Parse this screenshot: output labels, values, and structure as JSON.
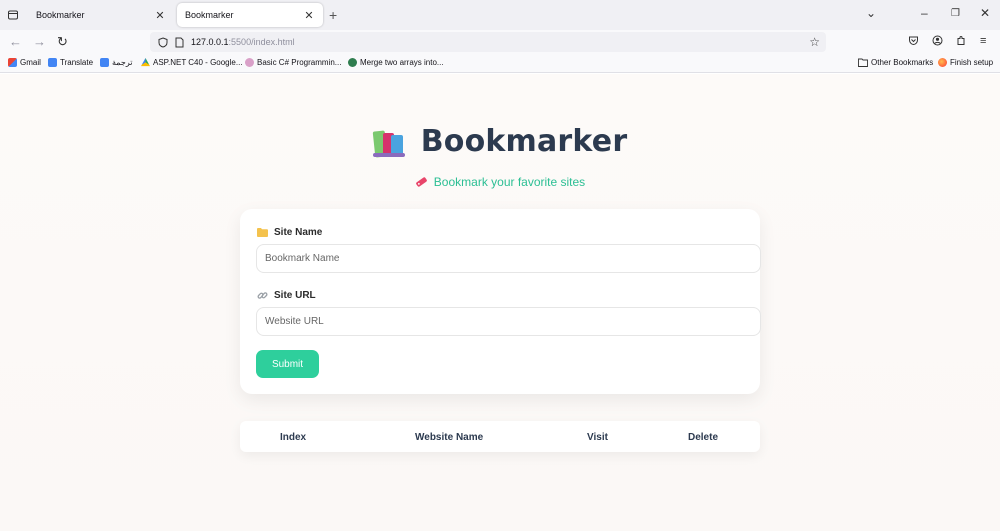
{
  "browser": {
    "tabs": [
      {
        "title": "Bookmarker",
        "active": false
      },
      {
        "title": "Bookmarker",
        "active": true
      }
    ],
    "url_host": "127.0.0.1",
    "url_rest": ":5500/index.html",
    "bookmarks": [
      {
        "label": "Gmail",
        "icon": "gmail-icon"
      },
      {
        "label": "Translate",
        "icon": "translate-icon"
      },
      {
        "label": "ترجمة",
        "icon": "translate-icon"
      },
      {
        "label": "ASP.NET C40 - Google...",
        "icon": "drive-icon"
      },
      {
        "label": "Basic C# Programmin...",
        "icon": "course-icon"
      },
      {
        "label": "Merge two arrays into...",
        "icon": "site-icon"
      }
    ],
    "other_bookmarks": "Other Bookmarks",
    "finish_setup": "Finish setup"
  },
  "app": {
    "title": "Bookmarker",
    "subtitle": "Bookmark your favorite sites",
    "form": {
      "site_name_label": "Site Name",
      "site_name_placeholder": "Bookmark Name",
      "site_url_label": "Site URL",
      "site_url_placeholder": "Website URL",
      "submit_label": "Submit"
    },
    "table": {
      "headers": [
        "Index",
        "Website Name",
        "Visit",
        "Delete"
      ]
    }
  },
  "colors": {
    "accent": "#2ecf9c",
    "title": "#2c3a4f"
  }
}
